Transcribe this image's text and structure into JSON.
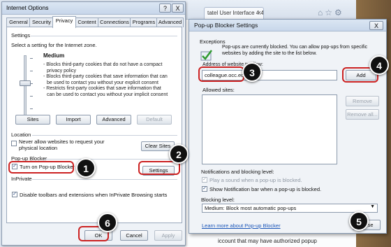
{
  "background": {
    "tab_title": "tatel User Interface 4.4",
    "tab_close": "×",
    "icons_text": "⌂☆⚙",
    "bottom_text": "iccount that may have authorized popup"
  },
  "internet_options": {
    "title": "Internet Options",
    "help": "?",
    "close": "X",
    "tabs": [
      "General",
      "Security",
      "Privacy",
      "Content",
      "Connections",
      "Programs",
      "Advanced"
    ],
    "active_tab": "Privacy",
    "settings": {
      "heading": "Settings",
      "instruction": "Select a setting for the Internet zone.",
      "level": "Medium",
      "desc_lines": [
        "- Blocks third-party cookies that do not have a compact",
        "privacy policy",
        "- Blocks third-party cookies that save information that can",
        "be used to contact you without your explicit consent",
        "- Restricts first-party cookies that save information that",
        "can be used to contact you without your implicit consent"
      ],
      "buttons": {
        "sites": "Sites",
        "import": "Import",
        "advanced": "Advanced",
        "default": "Default"
      }
    },
    "location": {
      "heading": "Location",
      "checkbox_line1": "Never allow websites to request your",
      "checkbox_line2": "physical location",
      "clear_sites": "Clear Sites"
    },
    "popup": {
      "heading": "Pop-up Blocker",
      "turn_on": "Turn on Pop-up Blocker",
      "settings_button": "Settings"
    },
    "inprivate": {
      "heading": "InPrivate",
      "disable": "Disable toolbars and extensions when InPrivate Browsing starts"
    },
    "footer": {
      "ok": "OK",
      "cancel": "Cancel",
      "apply": "Apply"
    }
  },
  "popup_settings": {
    "title": "Pop-up Blocker Settings",
    "close": "X",
    "exceptions_heading": "Exceptions",
    "exceptions_text_1": "Pop-ups are currently blocked.  You can allow pop-ups from specific",
    "exceptions_text_2": "websites by adding the site to the list below.",
    "address_label": "Address of website to allow:",
    "address_value": "colleague.occ.edu",
    "add": "Add",
    "allowed_label": "Allowed sites:",
    "remove": "Remove",
    "remove_all": "Remove all...",
    "notif_heading": "Notifications and blocking level:",
    "play_sound": "Play a sound when a pop-up is blocked.",
    "show_bar": "Show Notification bar when a pop-up is blocked.",
    "blocking_level_label": "Blocking level:",
    "blocking_level_value": "Medium: Block most automatic pop-ups",
    "learn_more": "Learn more about Pop-up Blocker",
    "close_button": "Close"
  },
  "callouts": [
    "1",
    "2",
    "3",
    "4",
    "5",
    "6"
  ],
  "colors": {
    "callout_red": "#cc2222",
    "callout_badge": "#111111",
    "link_blue": "#1a55b8"
  }
}
